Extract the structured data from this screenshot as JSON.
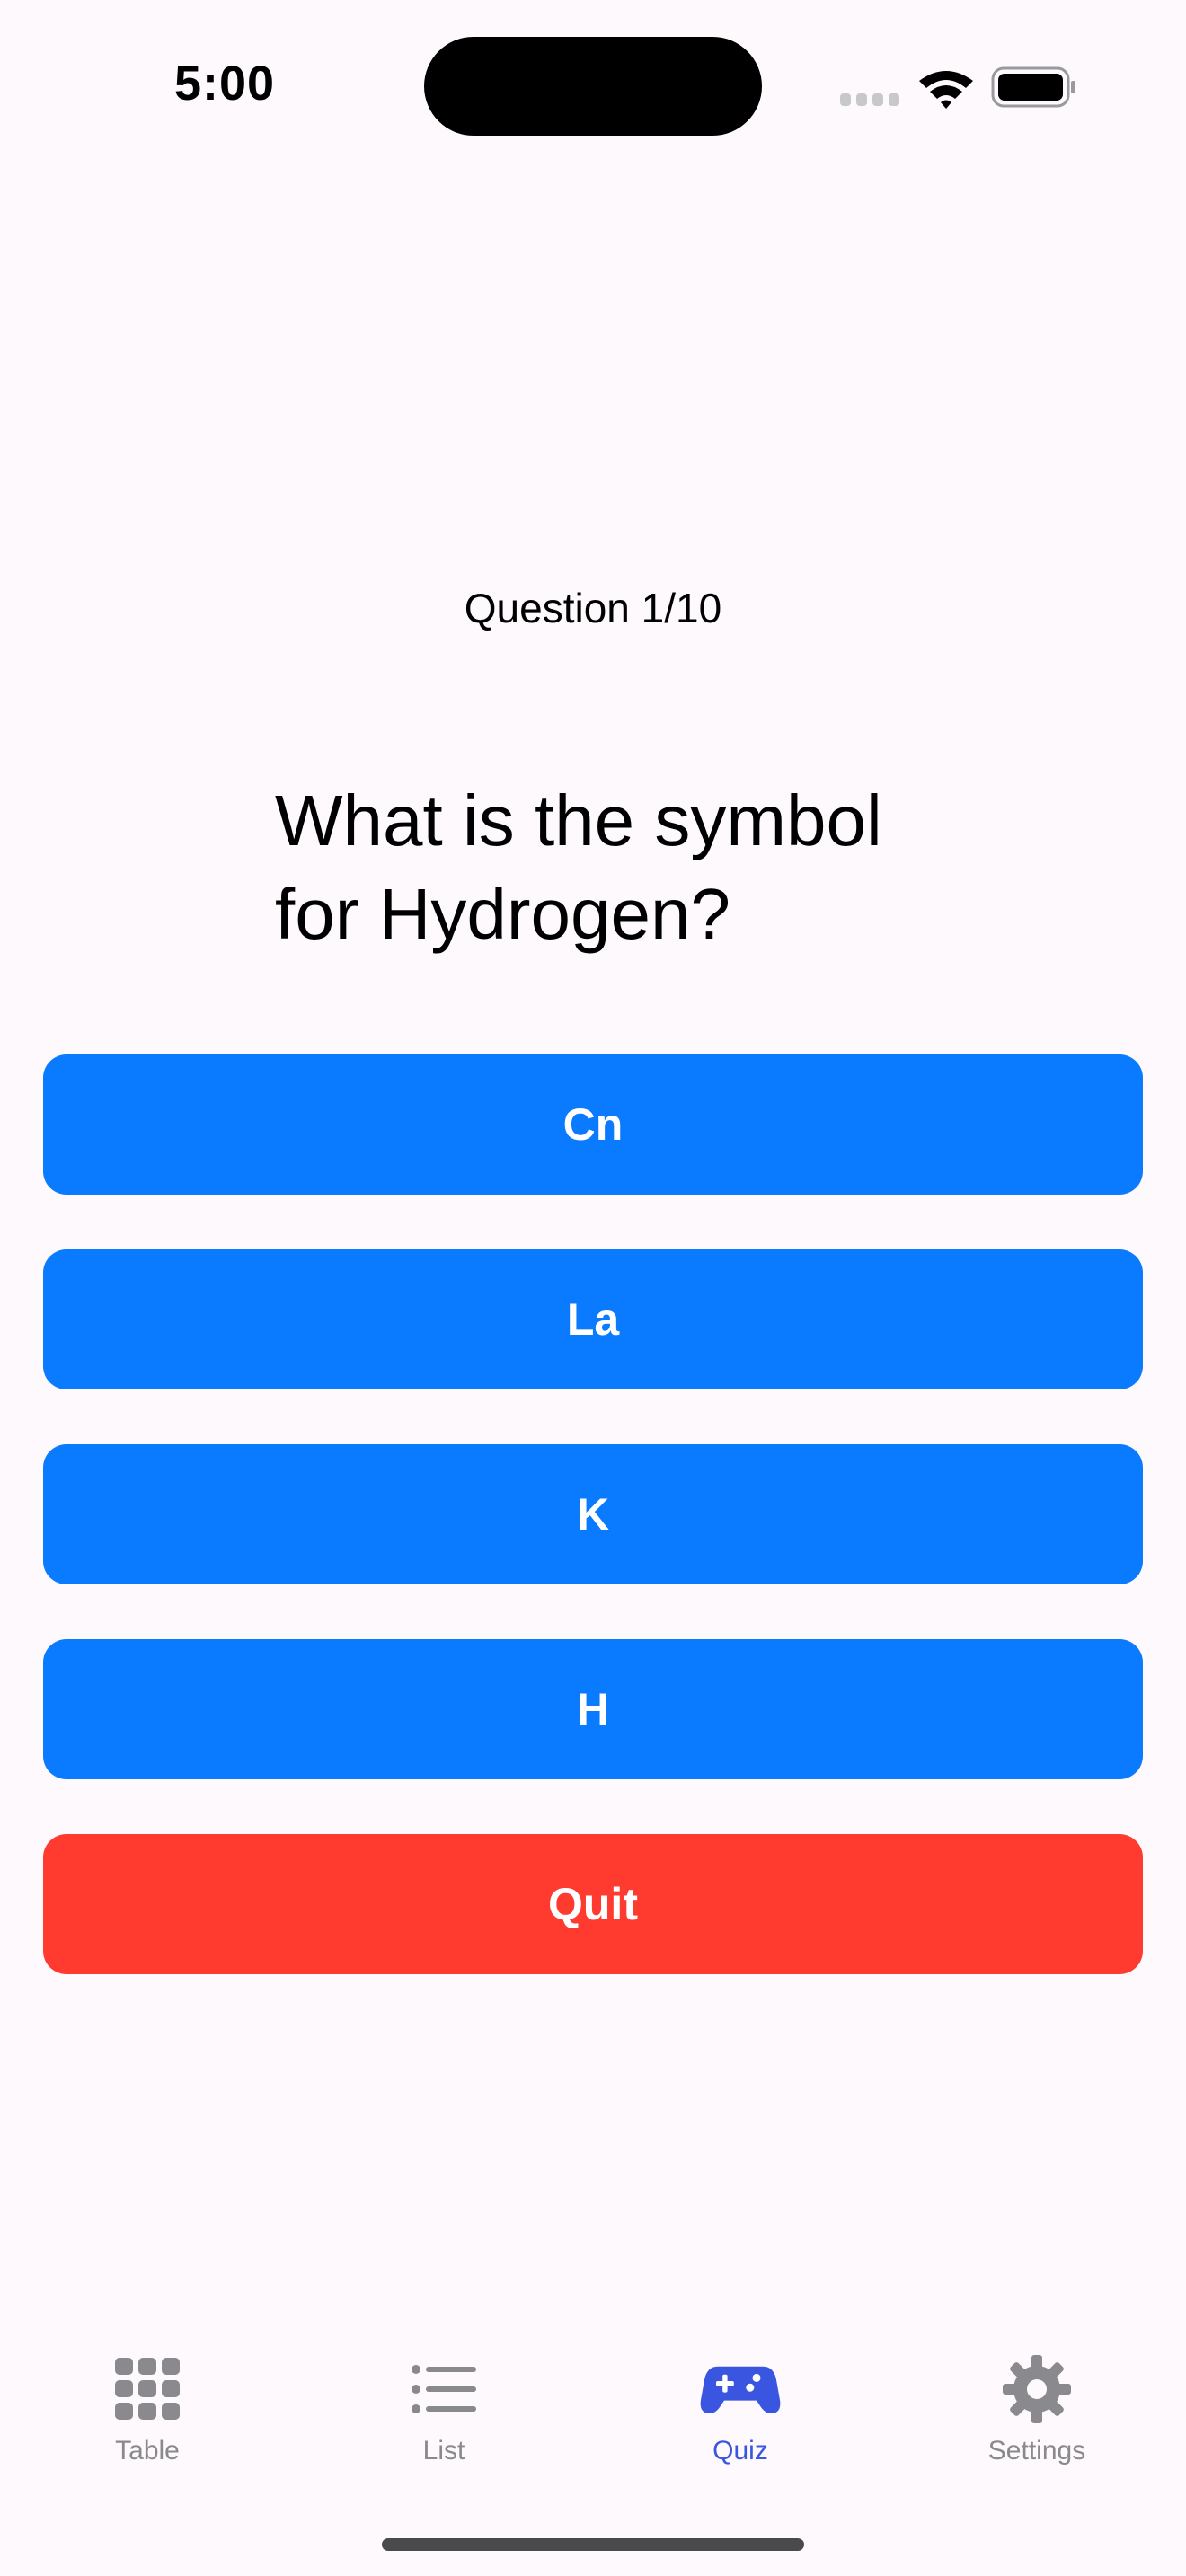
{
  "status_bar": {
    "time": "5:00"
  },
  "quiz": {
    "counter": "Question 1/10",
    "question": "What is the symbol for Hydrogen?",
    "answers": [
      "Cn",
      "La",
      "K",
      "H"
    ],
    "quit_label": "Quit"
  },
  "tab_bar": {
    "items": [
      {
        "label": "Table",
        "icon": "grid-icon"
      },
      {
        "label": "List",
        "icon": "list-icon"
      },
      {
        "label": "Quiz",
        "icon": "gamecontroller-icon"
      },
      {
        "label": "Settings",
        "icon": "gear-icon"
      }
    ],
    "active": "Quiz"
  },
  "colors": {
    "background": "#fdf9fc",
    "answer_button": "#0a7aff",
    "quit_button": "#ff3b30",
    "tab_active": "#3a56e0",
    "tab_inactive": "#8a8a8e"
  }
}
